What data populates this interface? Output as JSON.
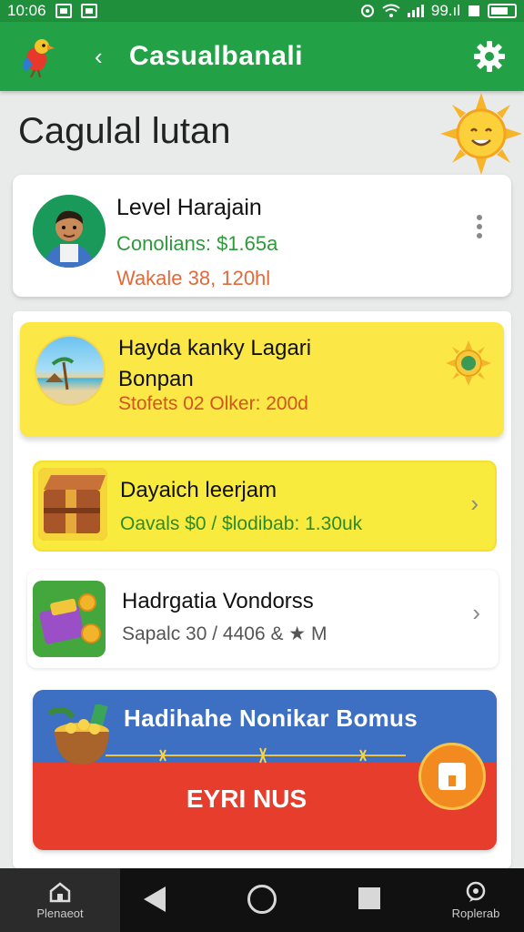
{
  "status_bar": {
    "time": "10:06",
    "network": "99.ıl"
  },
  "app_bar": {
    "back_glyph": "‹",
    "title": "Casualbanali"
  },
  "page": {
    "title": "Cagulal lutan"
  },
  "profile": {
    "name": "Level Harajain",
    "line1": "Conolians: $1.65a",
    "line2": "Wakale 38, 120hl"
  },
  "items": [
    {
      "title_line1": "Hayda kanky Lagari",
      "title_line2": "Bonpan",
      "subtitle": "Stofets 02 Olker: 200d"
    },
    {
      "title": "Dayaich leerjam",
      "subtitle": "Oavals $0 / $lodibab: 1.30uk"
    },
    {
      "title": "Hadrgatia Vondorss",
      "subtitle": "Sapalc 30 / 4406 & ★ M"
    }
  ],
  "chevron_glyph": "›",
  "promo": {
    "title": "Hadihahe Nonikar Bomus",
    "cta": "EYRI NUS"
  },
  "nav": {
    "home_label": "Plenaeot",
    "right_label": "Roplerab"
  },
  "colors": {
    "app_bar": "#22a147",
    "status_bar": "#1f8f3c",
    "card_yellow": "#fbe846",
    "promo_blue": "#3d6fc2",
    "promo_red": "#e63d2c",
    "fab_orange": "#f28a1f"
  },
  "icons": [
    "parrot-logo-icon",
    "back-chevron-icon",
    "gear-icon",
    "sun-mascot-icon",
    "kebab-menu-icon",
    "beach-icon",
    "globe-badge-icon",
    "treasure-chest-icon",
    "gift-box-icon",
    "gold-pot-icon",
    "home-icon",
    "chat-icon"
  ]
}
